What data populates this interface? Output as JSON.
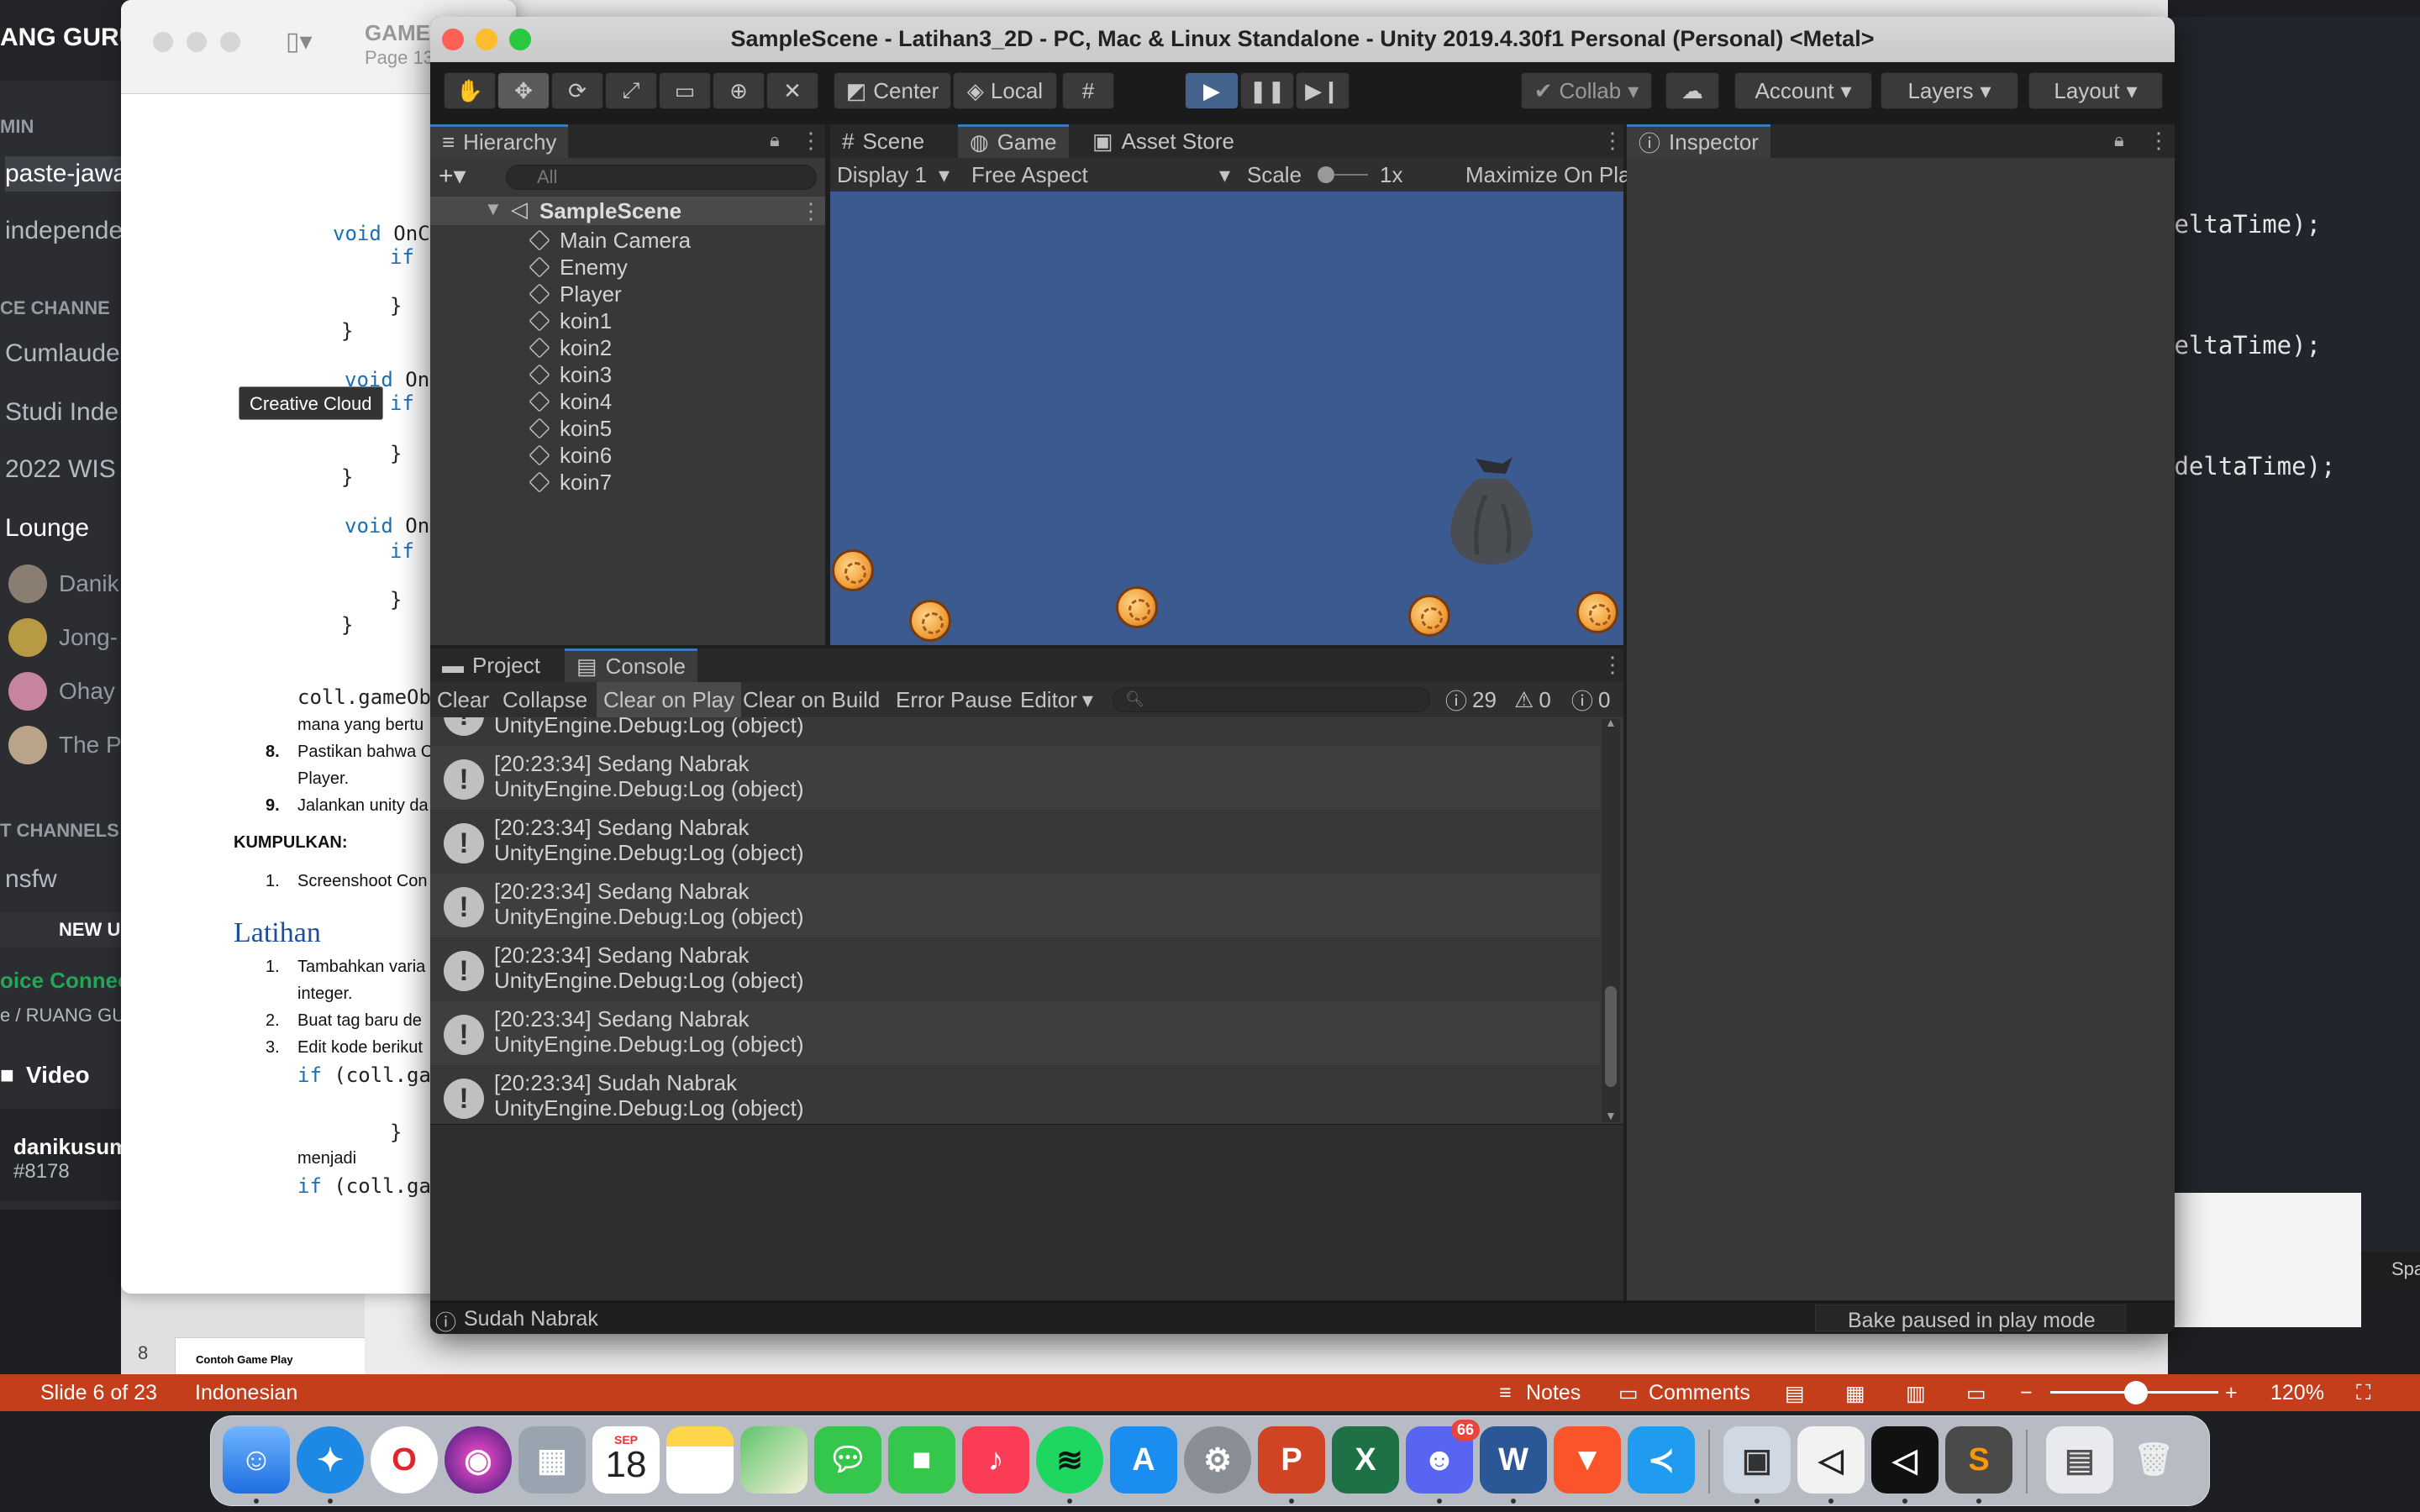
{
  "discord": {
    "server_name": "ANG GURU",
    "categories": {
      "admin": "MIN",
      "voice": "CE CHANNE",
      "text": "T CHANNELS"
    },
    "channels": [
      "paste-jawa",
      "independe",
      "Cumlaude",
      "Studi Inde",
      "2022 WIS",
      "Lounge",
      "nsfw"
    ],
    "members": [
      "Danik",
      "Jong-",
      "Ohay",
      "The P"
    ],
    "new_badge": "NEW U",
    "voice_connected": "oice Connect",
    "voice_sub": "e / RUANG GU",
    "video_label": "Video",
    "user_name": "danikusum",
    "user_tag": "#8178"
  },
  "document": {
    "window_title": "GAME",
    "page_label": "Page 13",
    "tooltip": "Creative Cloud",
    "code_lines": [
      {
        "kw": "void",
        "rest": " OnCo"
      },
      {
        "kw": "if",
        "rest": " ("
      },
      {
        "kw": "",
        "rest": "}"
      },
      {
        "kw": "",
        "rest": "}"
      },
      {
        "kw": "void",
        "rest": " OnC"
      },
      {
        "kw": "if",
        "rest": " ("
      },
      {
        "kw": "",
        "rest": "}"
      },
      {
        "kw": "",
        "rest": "}"
      },
      {
        "kw": "void",
        "rest": " OnC"
      },
      {
        "kw": "if",
        "rest": " ("
      },
      {
        "kw": "",
        "rest": "}"
      },
      {
        "kw": "",
        "rest": "}"
      }
    ],
    "body_code": "coll.gameObj",
    "text_lines": [
      "mana yang bertu",
      "8.",
      "Pastikan bahwa C",
      "Player.",
      "9.",
      "Jalankan unity da",
      "KUMPULKAN:",
      "1.",
      "Screenshoot Con"
    ],
    "heading": "Latihan",
    "latihan_items": [
      "1.",
      "Tambahkan varia",
      "integer.",
      "2.",
      "Buat tag baru de",
      "3.",
      "Edit kode berikut"
    ],
    "latihan_code": {
      "kw": "if",
      "rest": " (coll.gam"
    },
    "menjadi": "menjadi",
    "closing_brace": "}"
  },
  "powerpoint": {
    "slide_numbers": [
      "8"
    ],
    "thumb_title": "Contoh Game Play",
    "status": {
      "slide": "Slide 6 of 23",
      "language": "Indonesian",
      "notes": "Notes",
      "comments": "Comments",
      "zoom": "120%"
    }
  },
  "code_editor": {
    "lines": [
      "deltaTime);",
      "deltaTime);",
      ".deltaTime);"
    ],
    "status_right": "Spa"
  },
  "unity": {
    "window_title": "SampleScene - Latihan3_2D - PC, Mac & Linux Standalone - Unity 2019.4.30f1 Personal (Personal) <Metal>",
    "toolbar": {
      "pivot_center": "Center",
      "pivot_local": "Local",
      "collab": "Collab",
      "account": "Account",
      "layers": "Layers",
      "layout": "Layout"
    },
    "hierarchy": {
      "tab": "Hierarchy",
      "search_placeholder": "All",
      "scene": "SampleScene",
      "items": [
        "Main Camera",
        "Enemy",
        "Player",
        "koin1",
        "koin2",
        "koin3",
        "koin4",
        "koin5",
        "koin6",
        "koin7"
      ]
    },
    "center_tabs": [
      "Scene",
      "Game",
      "Asset Store"
    ],
    "game_bar": {
      "display": "Display 1",
      "aspect": "Free Aspect",
      "scale_label": "Scale",
      "scale_value": "1x",
      "maximize": "Maximize On Play"
    },
    "game_view_color": "#3b5a8f",
    "inspector_tab": "Inspector",
    "console": {
      "tabs": [
        "Project",
        "Console"
      ],
      "buttons": [
        "Clear",
        "Collapse",
        "Clear on Play",
        "Clear on Build",
        "Error Pause",
        "Editor"
      ],
      "counts": {
        "log": "29",
        "warn": "0",
        "error": "0"
      },
      "partial_row": "UnityEngine.Debug:Log (object)",
      "logs": [
        {
          "time_msg": "[20:23:34] Sedang Nabrak",
          "source": "UnityEngine.Debug:Log (object)"
        },
        {
          "time_msg": "[20:23:34] Sedang Nabrak",
          "source": "UnityEngine.Debug:Log (object)"
        },
        {
          "time_msg": "[20:23:34] Sedang Nabrak",
          "source": "UnityEngine.Debug:Log (object)"
        },
        {
          "time_msg": "[20:23:34] Sedang Nabrak",
          "source": "UnityEngine.Debug:Log (object)"
        },
        {
          "time_msg": "[20:23:34] Sedang Nabrak",
          "source": "UnityEngine.Debug:Log (object)"
        },
        {
          "time_msg": "[20:23:34] Sudah Nabrak",
          "source": "UnityEngine.Debug:Log (object)"
        }
      ]
    },
    "status": {
      "last_log": "Sudah Nabrak",
      "bake": "Bake paused in play mode"
    }
  },
  "dock": {
    "calendar_month": "SEP",
    "calendar_day": "18",
    "discord_badge": "66",
    "apps": [
      "Finder",
      "Safari",
      "Opera",
      "Siri",
      "Launchpad",
      "Calendar",
      "Notes",
      "Maps",
      "Messages",
      "FaceTime",
      "Music",
      "Spotify",
      "App Store",
      "System Preferences",
      "PowerPoint",
      "Excel",
      "Discord",
      "Word",
      "Brave",
      "VS Code",
      "Preview",
      "Unity Hub",
      "Unity",
      "Sublime Text",
      "Downloads",
      "Trash"
    ]
  }
}
